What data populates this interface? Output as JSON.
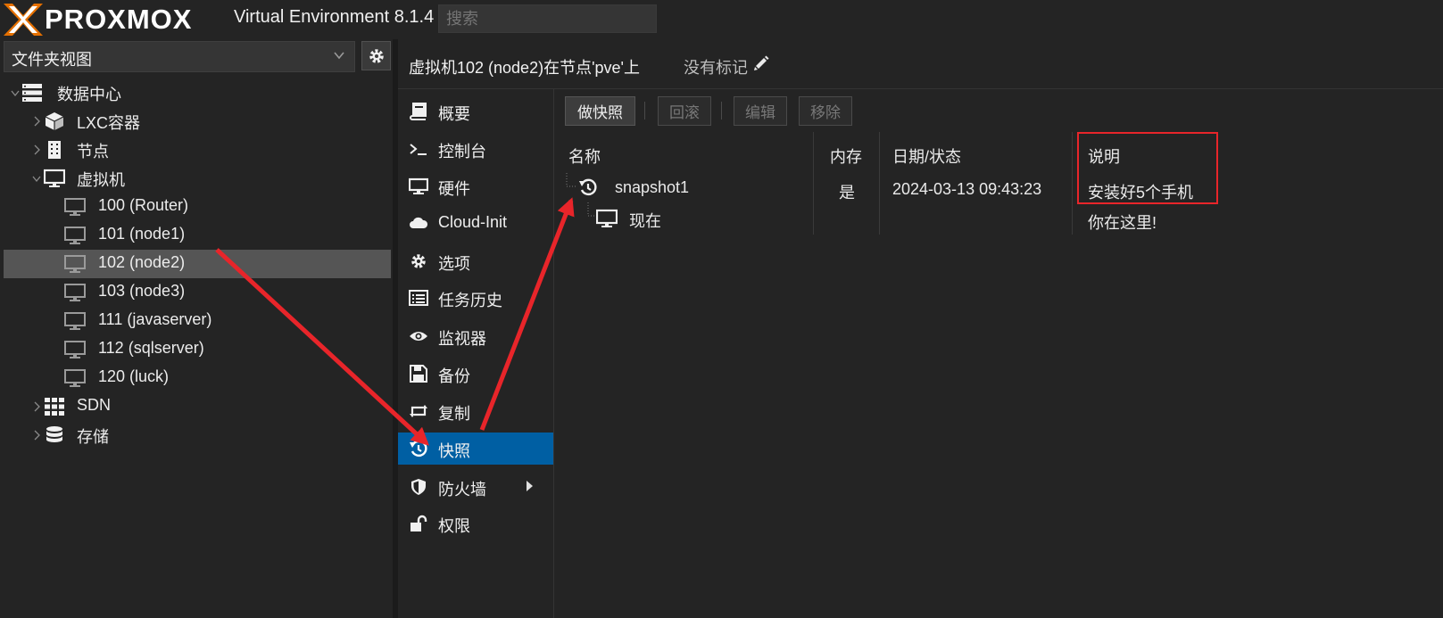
{
  "header": {
    "brand_text": "PROXMOX",
    "version_text": "Virtual Environment 8.1.4",
    "search_placeholder": "搜索"
  },
  "view_selector": {
    "selected": "文件夹视图"
  },
  "tree": {
    "datacenter": "数据中心",
    "lxc": "LXC容器",
    "nodes": "节点",
    "vms": "虚拟机",
    "vm_items": [
      "100 (Router)",
      "101 (node1)",
      "102 (node2)",
      "103 (node3)",
      "111 (javaserver)",
      "112 (sqlserver)",
      "120 (luck)"
    ],
    "sdn": "SDN",
    "storage": "存储"
  },
  "title": {
    "text": "虚拟机102 (node2)在节点'pve'上",
    "tags": "没有标记"
  },
  "menu": {
    "items": [
      "概要",
      "控制台",
      "硬件",
      "Cloud-Init",
      "选项",
      "任务历史",
      "监视器",
      "备份",
      "复制",
      "快照",
      "防火墙",
      "权限"
    ]
  },
  "toolbar": {
    "take_snapshot": "做快照",
    "rollback": "回滚",
    "edit": "编辑",
    "remove": "移除"
  },
  "grid": {
    "columns": [
      "名称",
      "内存",
      "日期/状态",
      "说明"
    ],
    "rows": [
      {
        "name": "snapshot1",
        "ram": "是",
        "date": "2024-03-13 09:43:23",
        "description": "安装好5个手机"
      },
      {
        "name": "现在",
        "ram": "",
        "date": "",
        "description": "你在这里!"
      }
    ]
  },
  "colors": {
    "accent": "#005fa3",
    "highlight": "#e8252a",
    "background": "#242424"
  }
}
